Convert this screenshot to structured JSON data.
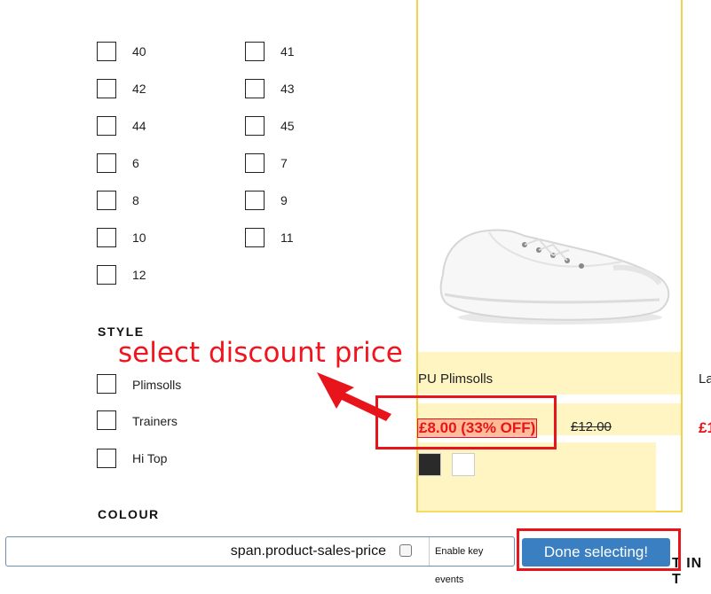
{
  "filters": {
    "sizes": [
      "40",
      "41",
      "42",
      "43",
      "44",
      "45",
      "6",
      "7",
      "8",
      "9",
      "10",
      "11",
      "12"
    ],
    "style_title": "STYLE",
    "styles": [
      "Plimsolls",
      "Trainers",
      "Hi Top"
    ],
    "colour_title": "COLOUR"
  },
  "product": {
    "name": "PU Plimsolls",
    "sale_price": "£8.00 (33% OFF)",
    "original_price": "£12.00",
    "swatches": [
      "#2a2a2a",
      "#ffffff"
    ]
  },
  "next_product": {
    "name_fragment": "La",
    "price_fragment": "£1"
  },
  "annotation": {
    "text": "select discount price",
    "color": "#f0141e"
  },
  "selector_bar": {
    "selector_value": "span.product-sales-price",
    "key_events_label": "Enable key events",
    "done_label": "Done selecting!",
    "bottom_text_fragment": "T IN T"
  },
  "colors": {
    "highlight": "#f3d34a",
    "button": "#3a7fc1",
    "sale": "#e8141b"
  }
}
